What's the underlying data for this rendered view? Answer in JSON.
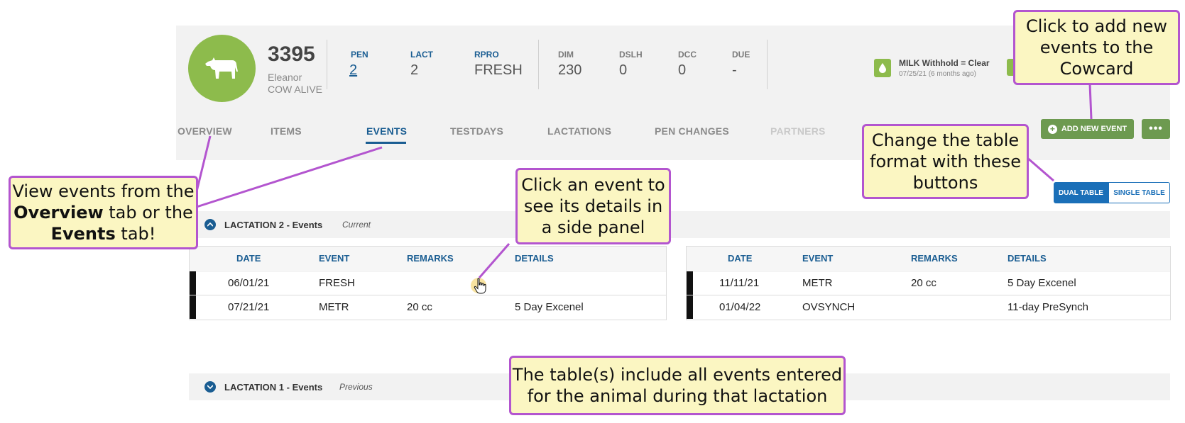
{
  "animal": {
    "id": "3395",
    "name": "Eleanor",
    "status": "COW ALIVE"
  },
  "stats": [
    {
      "label": "PEN",
      "value": "2"
    },
    {
      "label": "LACT",
      "value": "2"
    },
    {
      "label": "RPRO",
      "value": "FRESH"
    },
    {
      "label": "DIM",
      "value": "230"
    },
    {
      "label": "DSLH",
      "value": "0"
    },
    {
      "label": "DCC",
      "value": "0"
    },
    {
      "label": "DUE",
      "value": "-"
    }
  ],
  "withhold": {
    "label": "MILK Withhold = Clear",
    "date": "07/25/21 (6 months ago)"
  },
  "tabs": [
    "OVERVIEW",
    "ITEMS",
    "EVENTS",
    "TESTDAYS",
    "LACTATIONS",
    "PEN CHANGES",
    "PARTNERS"
  ],
  "buttons": {
    "add_event": "ADD NEW EVENT",
    "more": "•••",
    "dual_table": "DUAL TABLE",
    "single_table": "SINGLE TABLE"
  },
  "lactations": [
    {
      "title": "LACTATION 2 - Events",
      "subtitle": "Current"
    },
    {
      "title": "LACTATION 1 - Events",
      "subtitle": "Previous"
    }
  ],
  "table_headers": [
    "DATE",
    "EVENT",
    "REMARKS",
    "DETAILS"
  ],
  "left_table": [
    {
      "date": "06/01/21",
      "event": "FRESH",
      "remarks": "",
      "details": ""
    },
    {
      "date": "07/21/21",
      "event": "METR",
      "remarks": "20 cc",
      "details": "5 Day Excenel"
    }
  ],
  "right_table": [
    {
      "date": "11/11/21",
      "event": "METR",
      "remarks": "20 cc",
      "details": "5 Day Excenel"
    },
    {
      "date": "01/04/22",
      "event": "OVSYNCH",
      "remarks": "",
      "details": "11-day PreSynch"
    }
  ],
  "callouts": {
    "add_new": "Click to add new events to the Cowcard",
    "change_format": "Change the table format with these buttons",
    "click_event": "Click an event to see its details in a side panel",
    "view_events_a": "View events from the ",
    "view_events_b": "Overview",
    "view_events_c": " tab or the ",
    "view_events_d": "Events",
    "view_events_e": " tab!",
    "tables_include": "The table(s) include all events entered for the animal during that lactation"
  },
  "colors": {
    "accent_blue": "#1a5d92",
    "green": "#8dbb4c",
    "callout_border": "#b355cf",
    "callout_fill": "#fbf6c2"
  }
}
